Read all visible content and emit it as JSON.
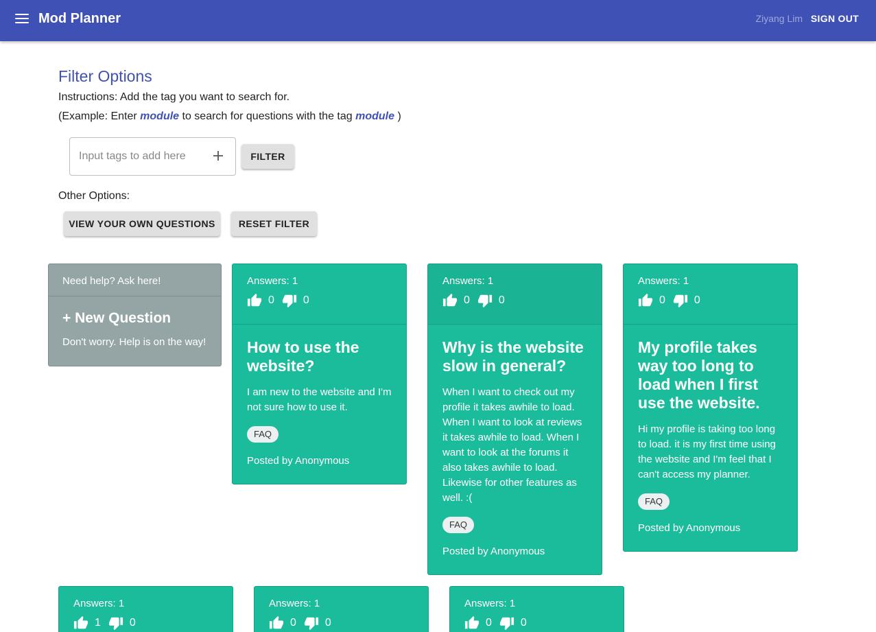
{
  "appbar": {
    "title": "Mod Planner",
    "username": "Ziyang Lim",
    "signout_label": "SIGN OUT"
  },
  "filter": {
    "title": "Filter Options",
    "instructions": "Instructions: Add the tag you want to search for.",
    "example_prefix": "(Example: Enter",
    "example_word": "module",
    "example_middle": "to search for questions with the tag",
    "example_word2": "module",
    "example_suffix": ")",
    "input_placeholder": "Input tags to add here",
    "filter_button": "FILTER",
    "other_label": "Other Options:",
    "view_own_button": "VIEW YOUR OWN QUESTIONS",
    "reset_button": "RESET FILTER"
  },
  "ask_card": {
    "header": "Need help? Ask here!",
    "title": "+ New Question",
    "subtitle": "Don't worry. Help is on the way!"
  },
  "questions": [
    {
      "answers": "Answers: 1",
      "upvotes": "0",
      "downvotes": "0",
      "title": "How to use the website?",
      "text": "I am new to the website and I'm not sure how to use it.",
      "tag": "FAQ",
      "posted": "Posted by Anonymous"
    },
    {
      "answers": "Answers: 1",
      "upvotes": "0",
      "downvotes": "0",
      "title": "Why is the website slow in general?",
      "text": "When I want to check out my profile it takes awhile to load. When I want to look at reviews it takes awhile to load. When I want to look at the forums it also takes awhile to load. Likewise for other features as well. :(",
      "tag": "FAQ",
      "posted": "Posted by Anonymous"
    },
    {
      "answers": "Answers: 1",
      "upvotes": "0",
      "downvotes": "0",
      "title": "My profile takes way too long to load when I first use the website.",
      "text": "Hi my profile is taking too long to load. it is my first time using the website and I'm feel that I can't access my planner.",
      "tag": "FAQ",
      "posted": "Posted by Anonymous"
    },
    {
      "answers": "Answers: 1",
      "upvotes": "1",
      "downvotes": "0"
    },
    {
      "answers": "Answers: 1",
      "upvotes": "0",
      "downvotes": "0"
    },
    {
      "answers": "Answers: 1",
      "upvotes": "0",
      "downvotes": "0"
    }
  ],
  "icons": {
    "menu": "menu-icon",
    "plus": "plus-icon",
    "upvote": "thumbs-up-icon",
    "downvote": "thumbs-down-icon"
  },
  "colors": {
    "appbar": "#3f51b5",
    "accent": "#3f51b5",
    "card": "#1abc9c",
    "ask_card": "#95a5a6"
  }
}
